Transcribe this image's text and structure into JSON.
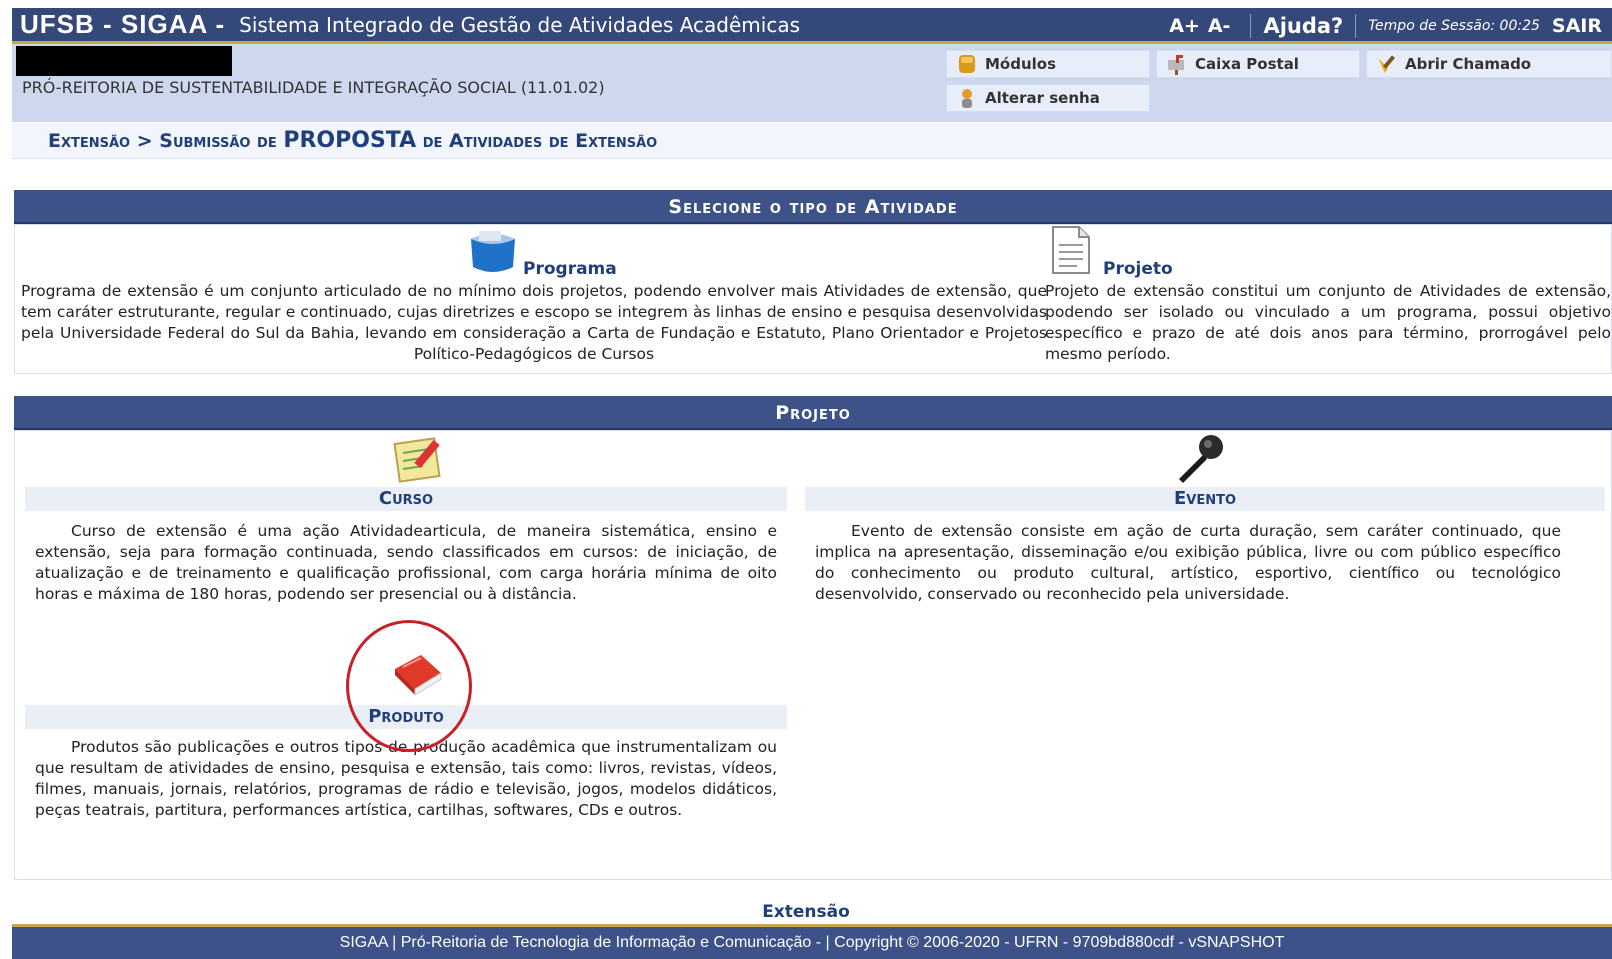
{
  "header": {
    "brand": "UFSB - SIGAA -",
    "system_name": "Sistema Integrado de Gestão de Atividades Acadêmicas",
    "font_increase": "A+",
    "font_decrease": "A-",
    "help": "Ajuda?",
    "session_label": "Tempo de Sessão: 00:25",
    "logout": "SAIR"
  },
  "infobar": {
    "unit": "PRÓ-REITORIA DE SUSTENTABILIDADE E INTEGRAÇÃO SOCIAL (11.01.02)",
    "modules": "Módulos",
    "mailbox": "Caixa Postal",
    "open_ticket": "Abrir Chamado",
    "change_password": "Alterar senha"
  },
  "breadcrumb": {
    "part1": "Extensão >",
    "part2": "Submissão de",
    "part3": "PROPOSTA",
    "part4": "de Atividades de Extensão"
  },
  "select_section": {
    "title": "Selecione o tipo de Atividade",
    "programa": {
      "label": "Programa",
      "description": "Programa de extensão é um conjunto articulado de no mínimo dois projetos, podendo envolver mais Atividades de extensão, que tem caráter estruturante, regular e continuado, cujas diretrizes e escopo se integrem às linhas de ensino e pesquisa desenvolvidas pela Universidade Federal do Sul da Bahia, levando em consideração a Carta de Fundação e Estatuto, Plano Orientador e Projetos Político-Pedagógicos de Cursos"
    },
    "projeto": {
      "label": "Projeto",
      "description": "Projeto de extensão constitui um conjunto de Atividades de extensão, podendo ser isolado ou vinculado a um programa, possui objetivo específico e prazo de até dois anos para término, prorrogável pelo mesmo período."
    }
  },
  "projeto_section": {
    "title": "Projeto",
    "curso": {
      "label": "Curso",
      "description": "Curso de extensão é uma ação Atividadearticula, de maneira sistemática, ensino e extensão, seja para formação continuada, sendo classificados em cursos: de iniciação, de atualização e de treinamento e qualificação profissional, com carga horária mínima de oito horas e máxima de 180 horas, podendo ser presencial ou à distância."
    },
    "evento": {
      "label": "Evento",
      "description": "Evento de extensão consiste em ação de curta duração, sem caráter continuado, que implica na apresentação, disseminação e/ou exibição pública, livre ou com público específico do conhecimento ou produto cultural, artístico, esportivo, científico ou tecnológico desenvolvido, conservado ou reconhecido pela universidade."
    },
    "produto": {
      "label": "Produto",
      "description": "Produtos são publicações e outros tipos de produção acadêmica que instrumentalizam ou que resultam de atividades de ensino, pesquisa e extensão, tais como: livros, revistas, vídeos, filmes, manuais, jornais, relatórios, programas de rádio e televisão, jogos, modelos didáticos, peças teatrais, partitura, performances artística, cartilhas, softwares, CDs e outros."
    }
  },
  "footer": {
    "module": "Extensão",
    "text": "SIGAA | Pró-Reitoria de Tecnologia de Informação e Comunicação -   | Copyright © 2006-2020 - UFRN - 9709bd880cdf - vSNAPSHOT"
  },
  "colors": {
    "header_bg": "#34487a",
    "accent_gold": "#c9a64a",
    "link_blue": "#1f3e7a",
    "annotation_red": "#c91f26"
  }
}
